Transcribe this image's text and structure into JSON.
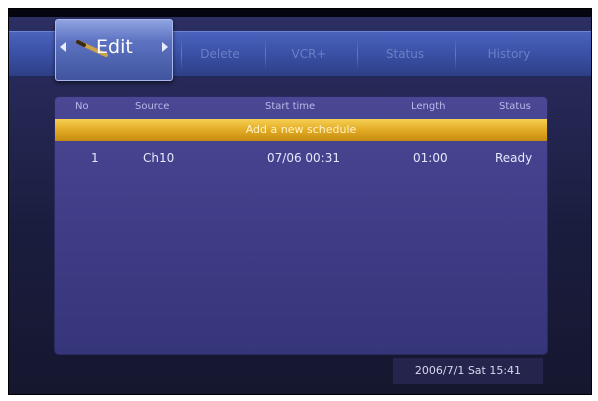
{
  "menu": {
    "tabs": [
      {
        "label": "Edit",
        "selected": true
      },
      {
        "label": "Delete"
      },
      {
        "label": "VCR+"
      },
      {
        "label": "Status"
      },
      {
        "label": "History"
      }
    ]
  },
  "table": {
    "headers": [
      "No",
      "Source",
      "Start time",
      "Length",
      "Status"
    ],
    "add_row_label": "Add a new schedule",
    "rows": [
      {
        "no": "1",
        "source": "Ch10",
        "start": "07/06 00:31",
        "length": "01:00",
        "status": "Ready"
      }
    ]
  },
  "footer": {
    "datetime": "2006/7/1 Sat 15:41"
  },
  "colors": {
    "menu_bar": "#3c52a8",
    "panel": "#3f3d86",
    "highlight": "#e0a821"
  }
}
